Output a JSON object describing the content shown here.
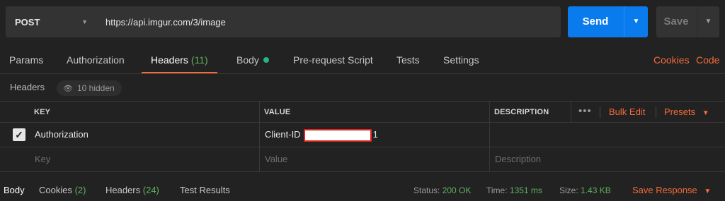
{
  "request": {
    "method": "POST",
    "url": "https://api.imgur.com/3/image",
    "send_label": "Send",
    "save_label": "Save"
  },
  "tabs": [
    {
      "label": "Params"
    },
    {
      "label": "Authorization"
    },
    {
      "label": "Headers",
      "count": "(11)"
    },
    {
      "label": "Body"
    },
    {
      "label": "Pre-request Script"
    },
    {
      "label": "Tests"
    },
    {
      "label": "Settings"
    }
  ],
  "links": {
    "cookies": "Cookies",
    "code": "Code"
  },
  "headers_section": {
    "title": "Headers",
    "hidden_label": "10 hidden"
  },
  "table": {
    "columns": {
      "key": "KEY",
      "value": "VALUE",
      "description": "DESCRIPTION"
    },
    "more": "•••",
    "bulk_edit": "Bulk Edit",
    "presets": "Presets",
    "rows": [
      {
        "key": "Authorization",
        "value_prefix": "Client-ID",
        "value_suffix": "1",
        "description": ""
      }
    ],
    "placeholders": {
      "key": "Key",
      "value": "Value",
      "description": "Description"
    }
  },
  "response": {
    "tabs": [
      {
        "label": "Body"
      },
      {
        "label": "Cookies",
        "count": "(2)"
      },
      {
        "label": "Headers",
        "count": "(24)"
      },
      {
        "label": "Test Results"
      }
    ],
    "status_label": "Status:",
    "status_value": "200 OK",
    "time_label": "Time:",
    "time_value": "1351 ms",
    "size_label": "Size:",
    "size_value": "1.43 KB",
    "save_response": "Save Response"
  },
  "colors": {
    "accent": "#f26b3a",
    "send": "#097bed",
    "success": "#5fb25f",
    "body_dot": "#26b47f"
  }
}
